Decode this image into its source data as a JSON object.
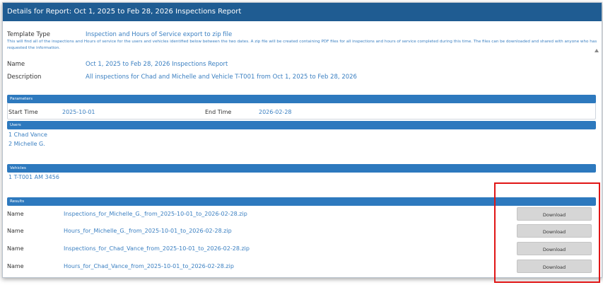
{
  "window": {
    "title": "Details for Report: Oct 1, 2025 to Feb 28, 2026 Inspections Report"
  },
  "details": {
    "template_type_label": "Template Type",
    "template_type_value": "Inspection and Hours of Service export to zip file",
    "template_description": "This will find all of the inspections and Hours of service for the users and vehicles identified below between the two dates. A zip file will be created containing PDF files for all inspections and hours of service completed during this time. The files can be downloaded and shared with anyone who has requested the information.",
    "name_label": "Name",
    "name_value": "Oct 1, 2025 to Feb 28, 2026 Inspections Report",
    "description_label": "Description",
    "description_value": "All inspections for Chad and Michelle and Vehicle T-T001 from Oct 1, 2025 to Feb 28, 2026"
  },
  "parameters": {
    "header": "Parameters",
    "start_label": "Start Time",
    "start_value": "2025-10-01",
    "end_label": "End Time",
    "end_value": "2026-02-28"
  },
  "users": {
    "header": "Users",
    "items": [
      "1 Chad Vance",
      "2 Michelle G."
    ]
  },
  "vehicles": {
    "header": "Vehicles",
    "items": [
      "1 T-T001 AM 3456"
    ]
  },
  "results": {
    "header": "Results",
    "rows": [
      {
        "label": "Name",
        "file": "Inspections_for_Michelle_G._from_2025-10-01_to_2026-02-28.zip",
        "button": "Download"
      },
      {
        "label": "Name",
        "file": "Hours_for_Michelle_G._from_2025-10-01_to_2026-02-28.zip",
        "button": "Download"
      },
      {
        "label": "Name",
        "file": "Inspections_for_Chad_Vance_from_2025-10-01_to_2026-02-28.zip",
        "button": "Download"
      },
      {
        "label": "Name",
        "file": "Hours_for_Chad_Vance_from_2025-10-01_to_2026-02-28.zip",
        "button": "Download"
      }
    ]
  },
  "colors": {
    "titlebar": "#1f5c92",
    "section_bar": "#2d79be",
    "link": "#3a7fc1",
    "highlight": "#e01515",
    "button": "#d6d6d6"
  },
  "icons": {
    "scroll": "scroll-up-arrow-icon"
  }
}
